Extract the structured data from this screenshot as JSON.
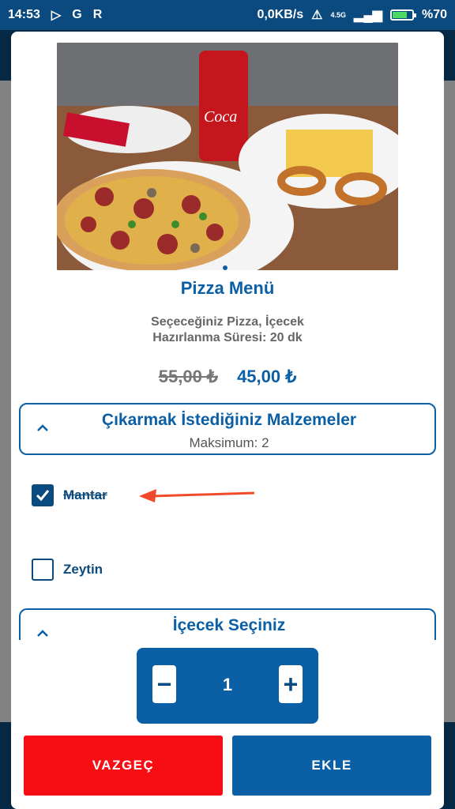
{
  "status_bar": {
    "time": "14:53",
    "network_speed": "0,0KB/s",
    "signal_label": "4.5G",
    "battery": "%70",
    "battery_level": 0.7
  },
  "product": {
    "title": "Pizza Menü",
    "description_line1": "Seçeceğiniz Pizza, İçecek",
    "description_line2": "Hazırlanma Süresi: 20 dk",
    "old_price": "55,00 ₺",
    "new_price": "45,00 ₺",
    "image_icon": "pizza-photo"
  },
  "remove_section": {
    "title": "Çıkarmak İstediğiniz Malzemeler",
    "subtitle": "Maksimum: 2",
    "options": [
      {
        "label": "Mantar",
        "checked": true
      },
      {
        "label": "Zeytin",
        "checked": false
      }
    ]
  },
  "drink_section": {
    "title": "İçecek Seçiniz"
  },
  "quantity": {
    "minus": "−",
    "value": "1",
    "plus": "+"
  },
  "actions": {
    "cancel_label": "VAZGEÇ",
    "add_label": "EKLE"
  },
  "colors": {
    "primary": "#0b5fa5",
    "dark": "#0b4a7e",
    "cancel": "#f70d14",
    "arrow": "#f04a2a"
  }
}
